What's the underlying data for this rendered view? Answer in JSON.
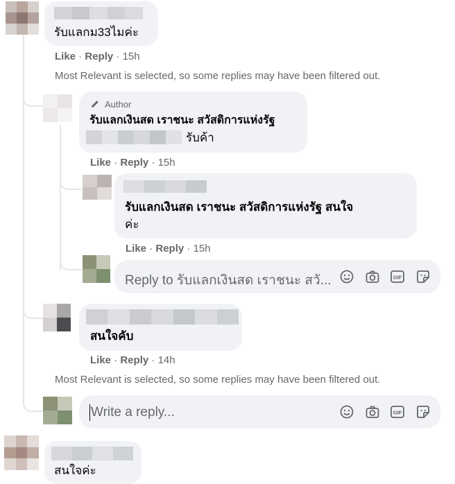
{
  "comments": [
    {
      "text": "รับแลกม33ไมค่ะ",
      "like": "Like",
      "reply": "Reply",
      "time": "15h"
    },
    {
      "author_badge": "Author",
      "name": "รับแลกเงินสด เราชนะ สวัสดิการแห่งรัฐ",
      "text": "รับค้า",
      "like": "Like",
      "reply": "Reply",
      "time": "15h"
    },
    {
      "text_line1": "รับแลกเงินสด เราชนะ สวัสดิการแห่งรัฐ สนใจ",
      "text_line2": "ค่ะ",
      "like": "Like",
      "reply": "Reply",
      "time": "15h"
    },
    {
      "text": "สนใจคับ",
      "like": "Like",
      "reply": "Reply",
      "time": "14h"
    },
    {
      "text": "สนใจค่ะ"
    }
  ],
  "filter_notice": "Most Relevant is selected, so some replies may have been filtered out.",
  "reply_box_1": {
    "placeholder": "Reply to รับแลกเงินสด เราชนะ สวั..."
  },
  "reply_box_2": {
    "placeholder": "Write a reply..."
  },
  "input_icons": [
    "emoji-icon",
    "camera-icon",
    "gif-icon",
    "sticker-icon"
  ],
  "gif_label": "GIF",
  "colors": {
    "bubble": "#f0f2f5",
    "meta": "#65676b",
    "thread_line": "#e4e6eb"
  }
}
